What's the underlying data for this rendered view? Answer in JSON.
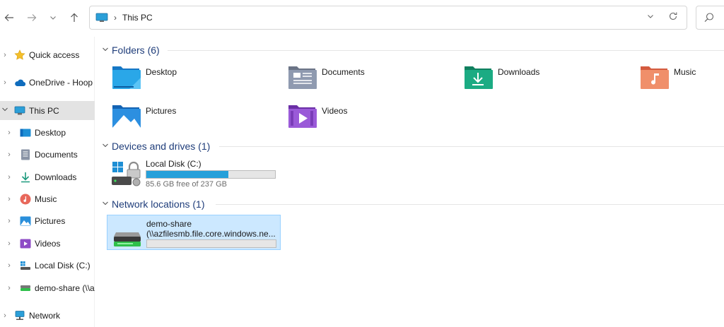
{
  "address": {
    "location": "This PC"
  },
  "colors": {
    "accent": "#26a0da",
    "selection": "#cce8ff",
    "group_title": "#1f3d7a"
  },
  "sidebar": {
    "items": [
      {
        "label": "Quick access",
        "icon": "star-icon"
      },
      {
        "label": "OneDrive - Hoop",
        "icon": "cloud-icon"
      },
      {
        "label": "This PC",
        "icon": "computer-icon",
        "selected": true
      },
      {
        "label": "Desktop",
        "icon": "desktop-icon"
      },
      {
        "label": "Documents",
        "icon": "documents-icon"
      },
      {
        "label": "Downloads",
        "icon": "download-icon"
      },
      {
        "label": "Music",
        "icon": "music-icon"
      },
      {
        "label": "Pictures",
        "icon": "pictures-icon"
      },
      {
        "label": "Videos",
        "icon": "videos-icon"
      },
      {
        "label": "Local Disk (C:)",
        "icon": "drive-icon"
      },
      {
        "label": "demo-share (\\\\a",
        "icon": "network-drive-icon"
      },
      {
        "label": "Network",
        "icon": "network-icon"
      }
    ]
  },
  "folders_group": {
    "title": "Folders (6)",
    "items": [
      {
        "name": "Desktop",
        "icon": "desktop-folder-icon"
      },
      {
        "name": "Documents",
        "icon": "documents-folder-icon"
      },
      {
        "name": "Downloads",
        "icon": "downloads-folder-icon"
      },
      {
        "name": "Music",
        "icon": "music-folder-icon"
      },
      {
        "name": "Pictures",
        "icon": "pictures-folder-icon"
      },
      {
        "name": "Videos",
        "icon": "videos-folder-icon"
      }
    ]
  },
  "drives_group": {
    "title": "Devices and drives (1)",
    "items": [
      {
        "name": "Local Disk (C:)",
        "free_text": "85.6 GB free of 237 GB",
        "used_fraction": 0.64
      }
    ]
  },
  "network_group": {
    "title": "Network locations (1)",
    "items": [
      {
        "name": "demo-share",
        "path": "(\\\\azfilesmb.file.core.windows.ne...",
        "used_fraction": 0.0
      }
    ]
  }
}
